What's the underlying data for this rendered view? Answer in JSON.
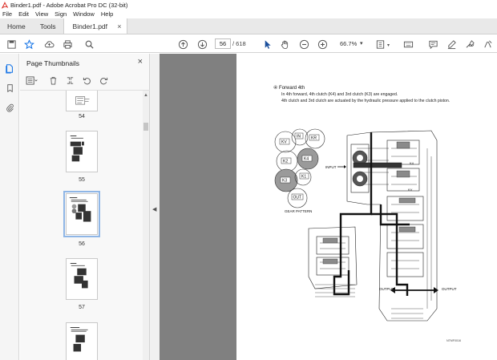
{
  "window": {
    "title": "Binder1.pdf - Adobe Acrobat Pro DC (32-bit)"
  },
  "menu": {
    "items": [
      "File",
      "Edit",
      "View",
      "Sign",
      "Window",
      "Help"
    ]
  },
  "tabs": {
    "home": "Home",
    "tools": "Tools",
    "doc": "Binder1.pdf",
    "close": "×"
  },
  "toolbar": {
    "page_current": "56",
    "page_total": "/  618",
    "zoom": "66.7%",
    "caret": "▾"
  },
  "panel": {
    "title": "Page Thumbnails",
    "close": "×",
    "thumbnails": [
      {
        "label": "54",
        "selected": false
      },
      {
        "label": "55",
        "selected": false
      },
      {
        "label": "56",
        "selected": true
      },
      {
        "label": "57",
        "selected": false
      },
      {
        "label": "",
        "selected": false
      }
    ]
  },
  "document": {
    "heading": "④ Forward 4th",
    "line1": "In 4th forward, 4th clutch (K4) and 3rd clutch (K3) are engaged.",
    "line2": "4th clutch and 3rd clutch are actuated by the hydraulic pressure applied to the clutch piston.",
    "diagram_labels": {
      "kv": "KV",
      "kr": "KR",
      "in": "IN",
      "k2": "K2",
      "k4": "K4",
      "k3": "K3",
      "k1": "K1",
      "out": "OUT",
      "gear_pattern": "GEAR PATTERN",
      "input": "INPUT",
      "output_left": "OUTPUT",
      "output_right": "OUTPUT",
      "k4_inline": "K4",
      "kv_inline": "KV"
    },
    "code": "NTMF0016"
  },
  "colors": {
    "accent": "#1473e6",
    "viewer_bg": "#808080",
    "selection": "#8fb6e6",
    "pdf_red": "#d9241c"
  }
}
